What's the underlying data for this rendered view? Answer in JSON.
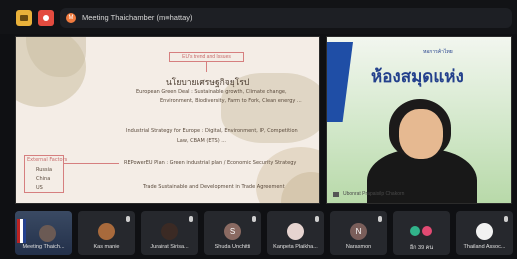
{
  "meeting": {
    "title": "Meeting Thaichamber (m≡hattay)",
    "badge_letter": "M",
    "colors": {
      "accent_yellow": "#e9b13a",
      "accent_red": "#e34b3f",
      "badge_orange": "#f07b3f"
    }
  },
  "toolbar": {
    "icons": [
      "chat-icon",
      "record-icon"
    ]
  },
  "slide": {
    "heading": "EU's trend and Issues",
    "thai_title": "นโยบายเศรษฐกิจยุโรป",
    "lines": [
      "European Green Deal : Sustainable growth, Climate change,",
      "Environment, Biodiversity, Farm to Fork, Clean energy ...",
      "",
      "Industrial Strategy for Europe : Digital, Environment, IP, Competition",
      "Law, CBAM (ETS) ...",
      "REPowerEU Plan : Green industrial plan / Economic Security Strategy",
      "Trade Sustainable and Development in Trade Agreement"
    ],
    "external_factors": {
      "title": "External Factors",
      "items": [
        "Russia",
        "China",
        "US"
      ]
    }
  },
  "speaker": {
    "name": "Ubonrat Prapaisilp Chakorn",
    "banner_text": "ห้องสมุดแห่ง",
    "banner_small": "หอการค้าไทย"
  },
  "participants": [
    {
      "name": "Meeting Thaich...",
      "kind": "camera"
    },
    {
      "name": "Kas manie",
      "kind": "photo",
      "avatar_color": "#a86a3c"
    },
    {
      "name": "Jurairat Sirisa...",
      "kind": "photo",
      "avatar_color": "#3b2a24"
    },
    {
      "name": "Shuda Unchitti",
      "kind": "initial",
      "initial": "S",
      "avatar_color": "#8a6a62"
    },
    {
      "name": "Kanpeta Plaikha...",
      "kind": "photo",
      "avatar_color": "#e6d4d0"
    },
    {
      "name": "Narasmon",
      "kind": "initial",
      "initial": "N",
      "avatar_color": "#7a5e5a"
    },
    {
      "name": "อีก 39 คน",
      "kind": "more",
      "dot_colors": [
        "#31b38a",
        "#e24a73"
      ]
    },
    {
      "name": "Thailand Assoc...",
      "kind": "photo",
      "avatar_color": "#f2f2f2"
    }
  ]
}
